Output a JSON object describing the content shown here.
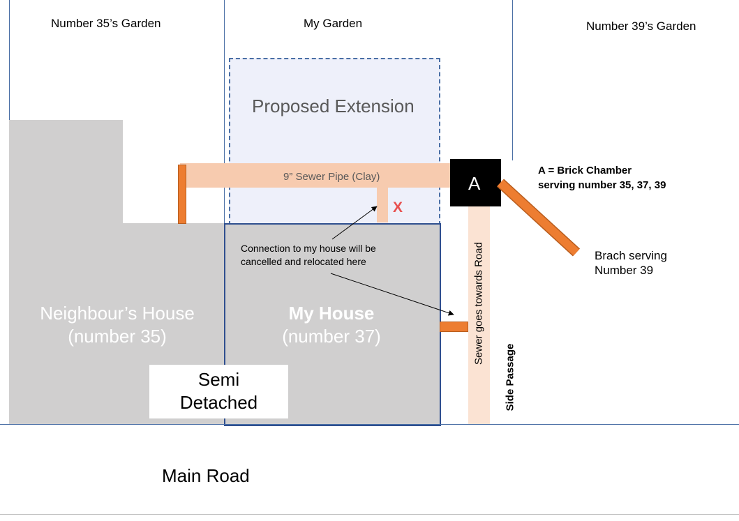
{
  "gardens": {
    "left": "Number 35’s Garden",
    "middle": "My Garden",
    "right": "Number 39’s Garden"
  },
  "extension": {
    "label": "Proposed Extension"
  },
  "sewer": {
    "pipe_label": "9” Sewer Pipe (Clay)",
    "cancel_mark": "X",
    "towards_road": "Sewer goes towards Road"
  },
  "chamber": {
    "letter": "A",
    "legend_line1": "A = Brick Chamber",
    "legend_line2": "serving number 35, 37, 39"
  },
  "branch": {
    "line1": "Brach serving",
    "line2": "Number 39"
  },
  "note": {
    "line1": "Connection to my house will be",
    "line2": "cancelled and relocated here"
  },
  "houses": {
    "neighbour_line1": "Neighbour’s House",
    "neighbour_line2": "(number 35)",
    "mine_line1": "My House",
    "mine_line2": "(number 37)"
  },
  "semi": {
    "line1": "Semi",
    "line2": "Detached"
  },
  "side_passage": "Side Passage",
  "road": "Main Road",
  "colors": {
    "house_grey": "#d0cfcf",
    "pipe_light": "#f7cbaf",
    "pipe_orange": "#ed7d31",
    "extension_fill": "#eef0fa",
    "boundary_blue": "#4a6fa5",
    "house_border": "#2f4f8f",
    "cancel_red": "#e8504f"
  }
}
